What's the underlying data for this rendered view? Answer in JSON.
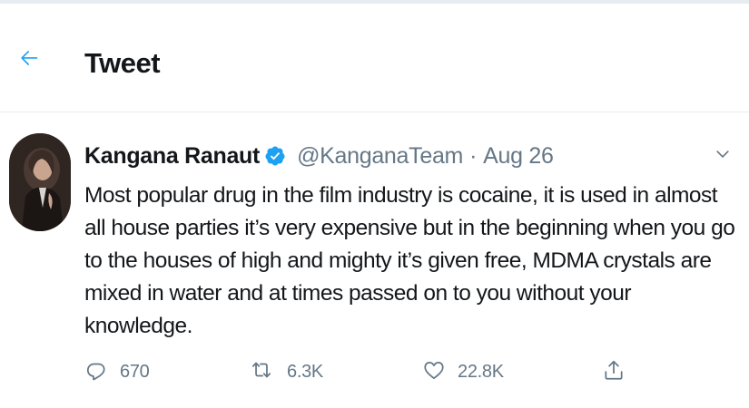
{
  "header": {
    "title": "Tweet",
    "back_icon": "arrow-left-icon"
  },
  "tweet": {
    "author_name": "Kangana Ranaut",
    "verified": true,
    "handle": "@KanganaTeam",
    "separator": "·",
    "date": "Aug 26",
    "text": "Most popular drug in the film industry is cocaine, it is used in almost all house parties it’s very expensive but in the beginning when you go to the houses of high and mighty it’s given free, MDMA crystals are mixed in water and at times passed on to you without your knowledge."
  },
  "actions": {
    "reply_count": "670",
    "retweet_count": "6.3K",
    "like_count": "22.8K"
  },
  "colors": {
    "accent": "#1da1f2",
    "text": "#14171a",
    "muted": "#657786",
    "border": "#e6ecf0"
  }
}
